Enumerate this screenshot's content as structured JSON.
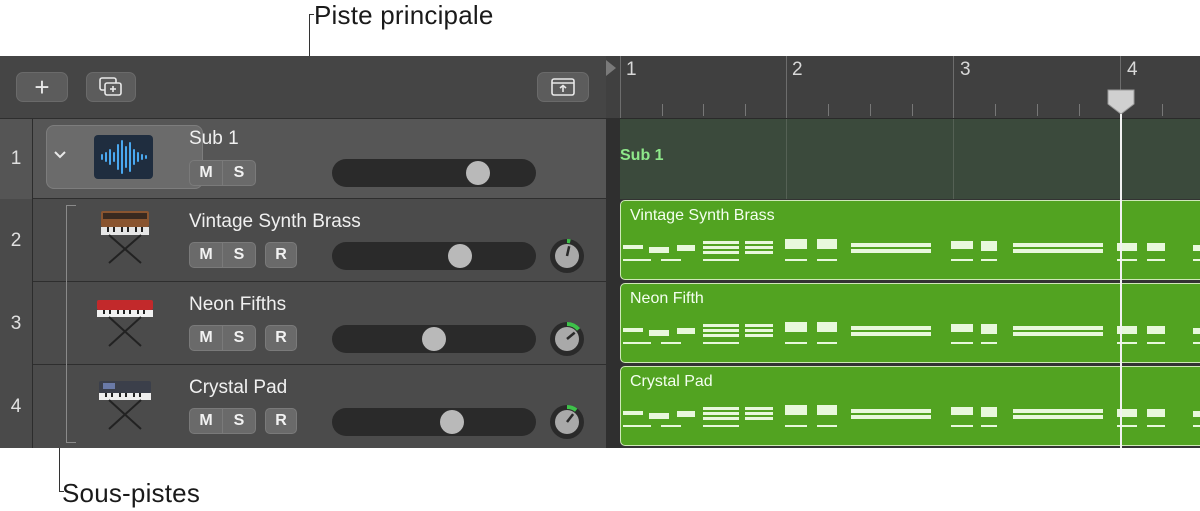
{
  "callouts": {
    "main_track": "Piste principale",
    "sub_tracks": "Sous-pistes"
  },
  "toolbar": {
    "add_track": "+",
    "icons": [
      "add-track-icon",
      "duplicate-track-icon",
      "collapse-track-stack-icon"
    ]
  },
  "ruler": {
    "bars": [
      "1",
      "2",
      "3",
      "4"
    ]
  },
  "tracks": [
    {
      "number": "1",
      "name": "Sub 1",
      "mute": "M",
      "solo": "S",
      "volume_level": 0.75,
      "icon": "audio-waveform-icon"
    },
    {
      "number": "2",
      "name": "Vintage Synth Brass",
      "mute": "M",
      "solo": "S",
      "record": "R",
      "volume_level": 0.65,
      "pan_level": 0.05,
      "icon": "vintage-synth-icon"
    },
    {
      "number": "3",
      "name": "Neon Fifths",
      "mute": "M",
      "solo": "S",
      "record": "R",
      "volume_level": 0.5,
      "pan_level": 0.2,
      "icon": "red-keyboard-icon"
    },
    {
      "number": "4",
      "name": "Crystal Pad",
      "mute": "M",
      "solo": "S",
      "record": "R",
      "volume_level": 0.6,
      "pan_level": 0.15,
      "icon": "synth-keyboard-icon"
    }
  ],
  "regions": {
    "folder_label": "Sub 1",
    "items": [
      "Vintage Synth Brass",
      "Neon Fifth",
      "Crystal Pad"
    ]
  },
  "colors": {
    "region_green": "#52a321",
    "folder_label_green": "#8ee88a",
    "pan_green": "#3ec24a"
  }
}
